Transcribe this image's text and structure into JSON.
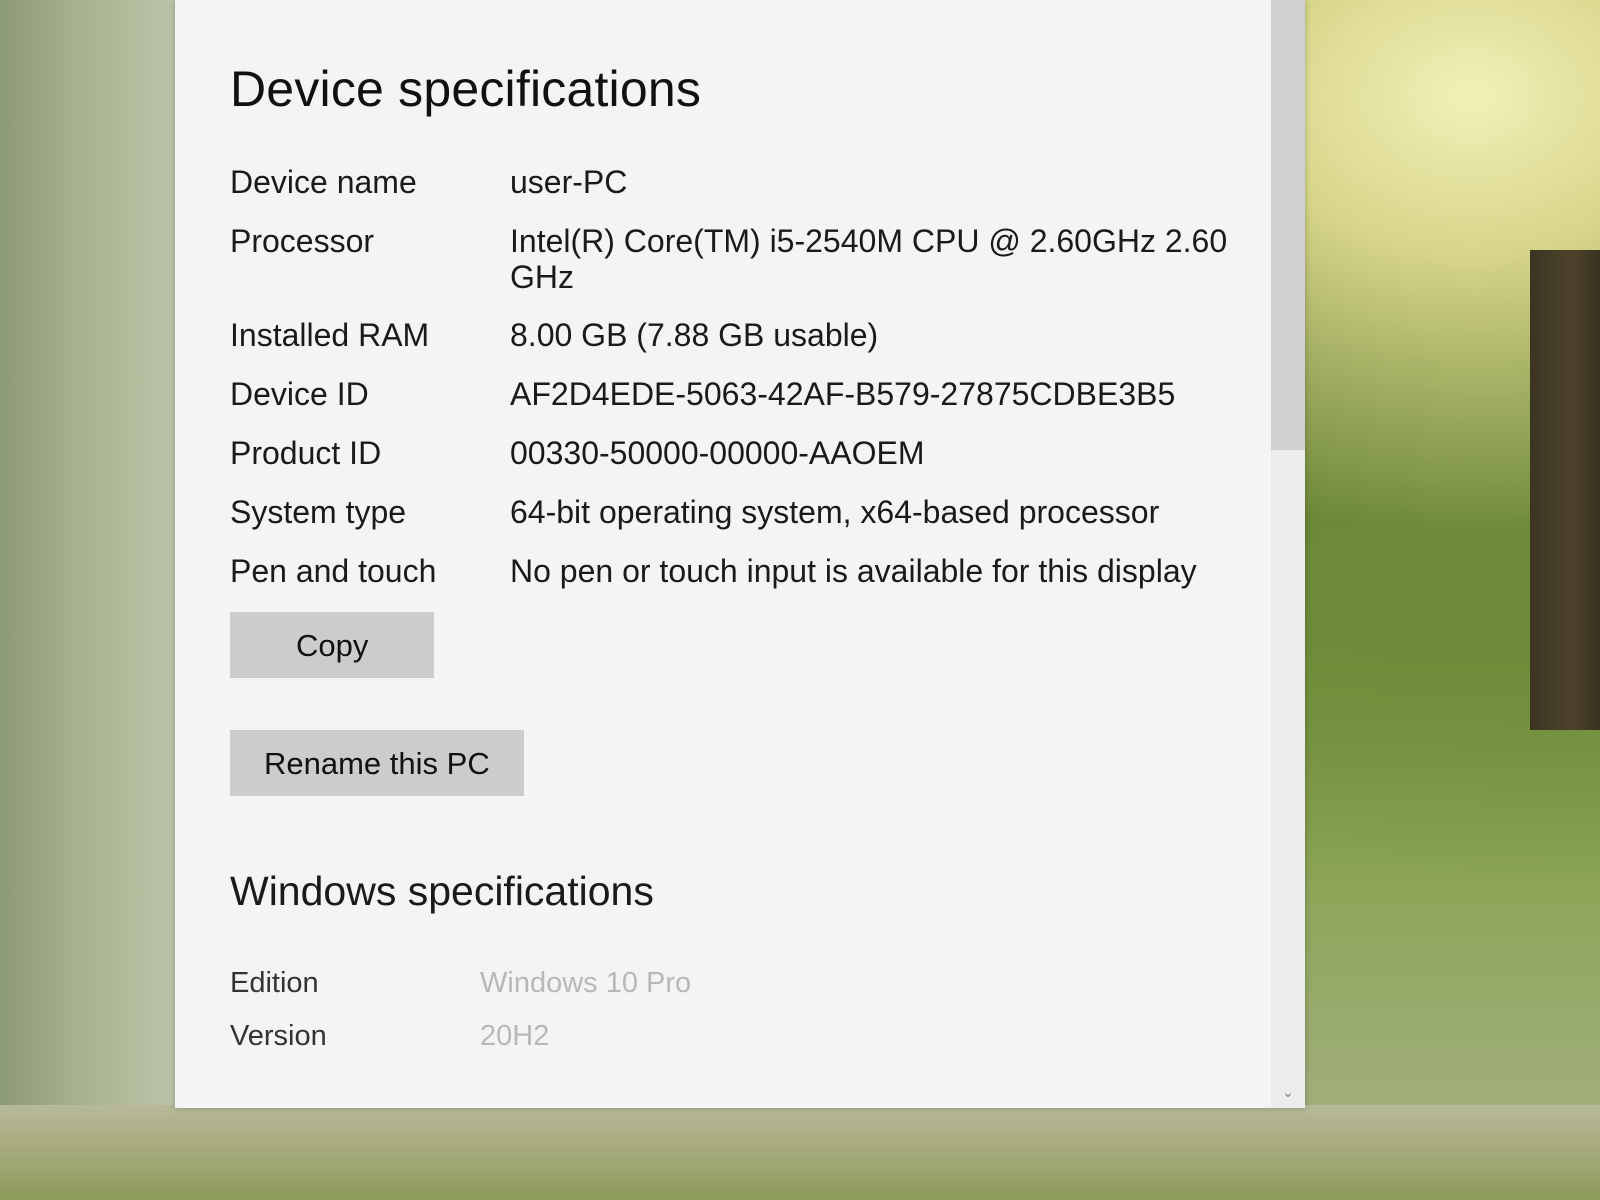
{
  "device_specs": {
    "title": "Device specifications",
    "rows": [
      {
        "label": "Device name",
        "value": "user-PC"
      },
      {
        "label": "Processor",
        "value": "Intel(R) Core(TM) i5-2540M CPU @ 2.60GHz   2.60 GHz"
      },
      {
        "label": "Installed RAM",
        "value": "8.00 GB (7.88 GB usable)"
      },
      {
        "label": "Device ID",
        "value": "AF2D4EDE-5063-42AF-B579-27875CDBE3B5"
      },
      {
        "label": "Product ID",
        "value": "00330-50000-00000-AAOEM"
      },
      {
        "label": "System type",
        "value": "64-bit operating system, x64-based processor"
      },
      {
        "label": "Pen and touch",
        "value": "No pen or touch input is available for this display"
      }
    ],
    "copy_button": "Copy",
    "rename_button": "Rename this PC"
  },
  "windows_specs": {
    "title": "Windows specifications",
    "rows": [
      {
        "label": "Edition",
        "value": "Windows 10 Pro"
      },
      {
        "label": "Version",
        "value": "20H2"
      }
    ]
  },
  "colors": {
    "window_background": "#f4f4f4",
    "button_background": "#cccccc",
    "faded_value_text": "#b8b8b8"
  },
  "icons": {
    "scroll_down": "chevron-down-icon"
  }
}
